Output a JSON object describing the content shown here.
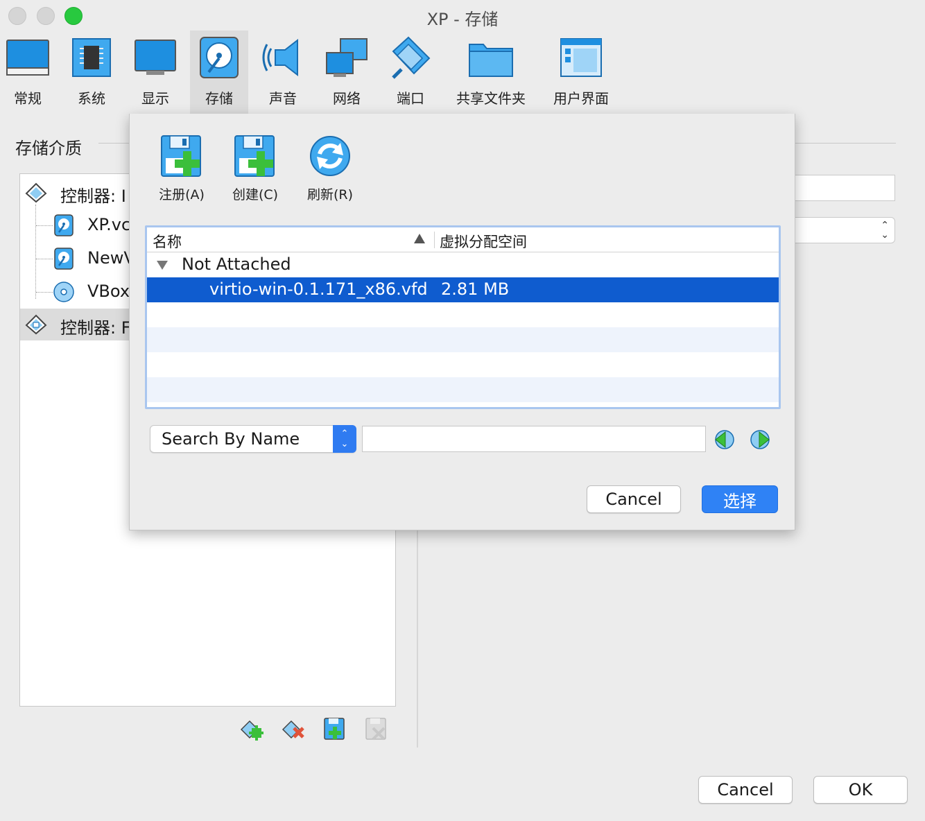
{
  "window": {
    "title": "XP - 存储"
  },
  "toolbar": {
    "items": [
      {
        "label": "常规",
        "icon": "general-icon"
      },
      {
        "label": "系统",
        "icon": "system-icon"
      },
      {
        "label": "显示",
        "icon": "display-icon"
      },
      {
        "label": "存储",
        "icon": "storage-icon",
        "active": true
      },
      {
        "label": "声音",
        "icon": "audio-icon"
      },
      {
        "label": "网络",
        "icon": "network-icon"
      },
      {
        "label": "端口",
        "icon": "ports-icon"
      },
      {
        "label": "共享文件夹",
        "icon": "shared-folder-icon"
      },
      {
        "label": "用户界面",
        "icon": "user-interface-icon"
      }
    ]
  },
  "storage": {
    "section_title": "存储介质",
    "tree": [
      {
        "label": "控制器: I",
        "icon": "controller-icon"
      },
      {
        "label": "XP.vc",
        "icon": "hard-disk-icon"
      },
      {
        "label": "NewV",
        "icon": "hard-disk-icon"
      },
      {
        "label": "VBox",
        "icon": "optical-disc-icon"
      },
      {
        "label": "控制器: F",
        "icon": "floppy-controller-icon"
      }
    ]
  },
  "dialog": {
    "tools": [
      {
        "label": "注册(A)",
        "icon": "add-disk-icon"
      },
      {
        "label": "创建(C)",
        "icon": "create-disk-icon"
      },
      {
        "label": "刷新(R)",
        "icon": "refresh-icon"
      }
    ],
    "table": {
      "columns": [
        "名称",
        "虚拟分配空间"
      ],
      "group": "Not Attached",
      "rows": [
        {
          "name": "virtio-win-0.1.171_x86.vfd",
          "size": "2.81 MB",
          "selected": true
        }
      ]
    },
    "search": {
      "mode": "Search By Name",
      "value": ""
    },
    "cancel_label": "Cancel",
    "select_label": "选择"
  },
  "footer": {
    "cancel_label": "Cancel",
    "ok_label": "OK"
  },
  "colors": {
    "accent": "#2f82f5",
    "selection": "#0f5ccf",
    "icon_blue": "#1e8fe0"
  }
}
